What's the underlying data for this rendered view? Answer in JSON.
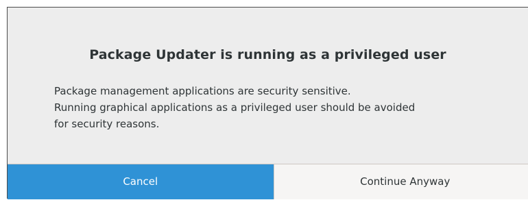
{
  "dialog": {
    "title": "Package Updater is running as a privileged user",
    "message_lines": [
      "Package management applications are security sensitive.",
      "Running graphical applications as a privileged user should be avoided",
      "for security reasons."
    ],
    "buttons": {
      "cancel_label": "Cancel",
      "continue_label": "Continue Anyway"
    }
  },
  "colors": {
    "dialog_background": "#ededed",
    "accent_button": "#2f92d6",
    "text": "#2e3436",
    "button_background": "#f6f5f4"
  }
}
